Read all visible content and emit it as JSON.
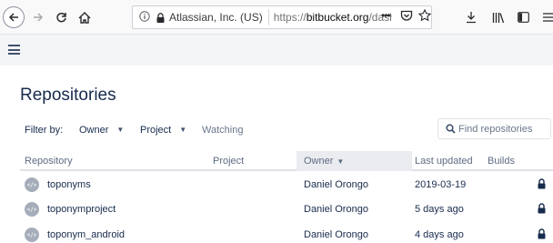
{
  "browser": {
    "site_identity": "Atlassian, Inc. (US)",
    "url_prefix": "https://",
    "url_host": "bitbucket.org",
    "url_path": "/dashb",
    "page_actions_label": "•••"
  },
  "page": {
    "title": "Repositories"
  },
  "filters": {
    "label": "Filter by:",
    "owner": "Owner",
    "project": "Project",
    "watching": "Watching",
    "search_placeholder": "Find repositories"
  },
  "table": {
    "columns": {
      "repository": "Repository",
      "project": "Project",
      "owner": "Owner",
      "last_updated": "Last updated",
      "builds": "Builds"
    },
    "rows": [
      {
        "name": "toponyms",
        "owner": "Daniel Orongo",
        "updated": "2019-03-19",
        "private": true
      },
      {
        "name": "toponymproject",
        "owner": "Daniel Orongo",
        "updated": "5 days ago",
        "private": true
      },
      {
        "name": "toponym_android",
        "owner": "Daniel Orongo",
        "updated": "4 days ago",
        "private": true
      }
    ]
  },
  "colors": {
    "header_bg": "#f4f5f7",
    "text_primary": "#172b4d",
    "text_subtle": "#6b778c",
    "sorted_column_bg": "#ebecf0"
  }
}
